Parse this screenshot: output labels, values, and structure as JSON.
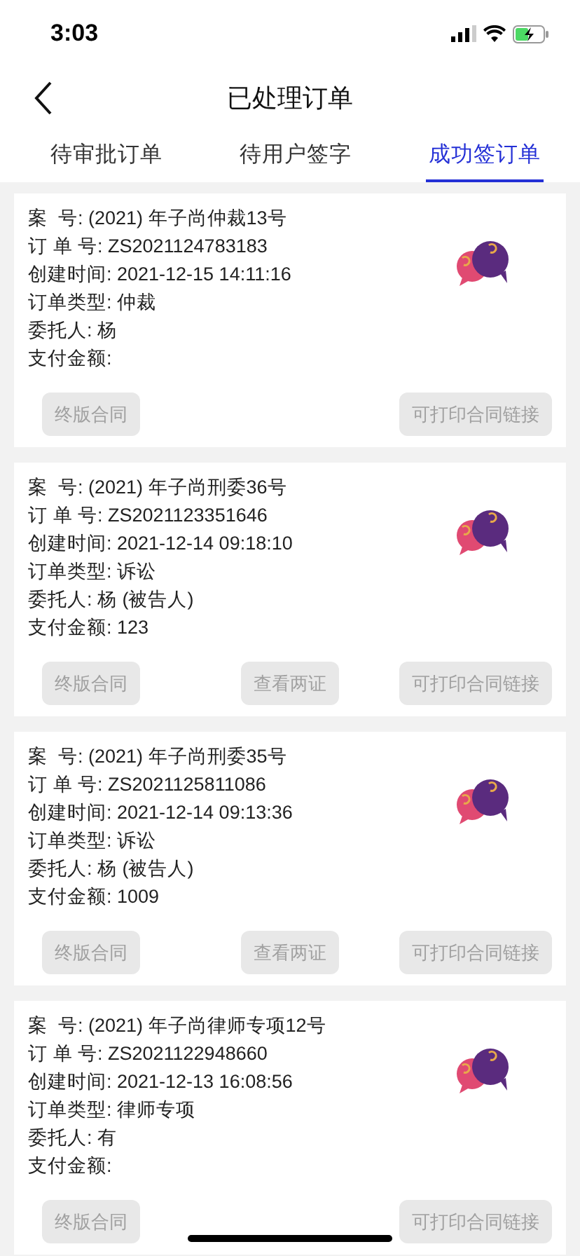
{
  "status_bar": {
    "time": "3:03"
  },
  "nav": {
    "title": "已处理订单"
  },
  "tabs": [
    {
      "label": "待审批订单",
      "selected": false
    },
    {
      "label": "待用户签字",
      "selected": false
    },
    {
      "label": "成功签订单",
      "selected": true
    }
  ],
  "orders": [
    {
      "fields": [
        {
          "label": "案  号:",
          "value": "(2021) 年子尚仲裁13号"
        },
        {
          "label": "订 单 号:",
          "value": "ZS2021124783183"
        },
        {
          "label": "创建时间:",
          "value": "2021-12-15 14:11:16"
        },
        {
          "label": "订单类型:",
          "value": "仲裁"
        },
        {
          "label": "委托人:",
          "value": "杨"
        },
        {
          "label": "支付金额:"
        }
      ],
      "buttons": [
        {
          "label": "终版合同",
          "kind": "left"
        },
        {
          "label": "可打印合同链接",
          "kind": "right"
        }
      ]
    },
    {
      "fields": [
        {
          "label": "案  号:",
          "value": "(2021) 年子尚刑委36号"
        },
        {
          "label": "订 单 号:",
          "value": "ZS2021123351646"
        },
        {
          "label": "创建时间:",
          "value": "2021-12-14 09:18:10"
        },
        {
          "label": "订单类型:",
          "value": "诉讼"
        },
        {
          "label": "委托人:",
          "value": "杨 (被告人)"
        },
        {
          "label": "支付金额:",
          "value": "123"
        }
      ],
      "buttons": [
        {
          "label": "终版合同",
          "kind": "left"
        },
        {
          "label": "查看两证",
          "kind": "middle"
        },
        {
          "label": "可打印合同链接",
          "kind": "right"
        }
      ]
    },
    {
      "fields": [
        {
          "label": "案  号:",
          "value": "(2021) 年子尚刑委35号"
        },
        {
          "label": "订 单 号:",
          "value": "ZS2021125811086"
        },
        {
          "label": "创建时间:",
          "value": "2021-12-14 09:13:36"
        },
        {
          "label": "订单类型:",
          "value": "诉讼"
        },
        {
          "label": "委托人:",
          "value": "杨 (被告人)"
        },
        {
          "label": "支付金额:",
          "value": "1009"
        }
      ],
      "buttons": [
        {
          "label": "终版合同",
          "kind": "left"
        },
        {
          "label": "查看两证",
          "kind": "middle"
        },
        {
          "label": "可打印合同链接",
          "kind": "right"
        }
      ]
    },
    {
      "fields": [
        {
          "label": "案  号:",
          "value": "(2021) 年子尚律师专项12号"
        },
        {
          "label": "订 单 号:",
          "value": "ZS2021122948660"
        },
        {
          "label": "创建时间:",
          "value": "2021-12-13 16:08:56"
        },
        {
          "label": "订单类型:",
          "value": "律师专项"
        },
        {
          "label": "委托人:",
          "value": "有"
        },
        {
          "label": "支付金额:"
        }
      ],
      "buttons": [
        {
          "label": "终版合同",
          "kind": "left"
        },
        {
          "label": "可打印合同链接",
          "kind": "right"
        }
      ]
    }
  ]
}
